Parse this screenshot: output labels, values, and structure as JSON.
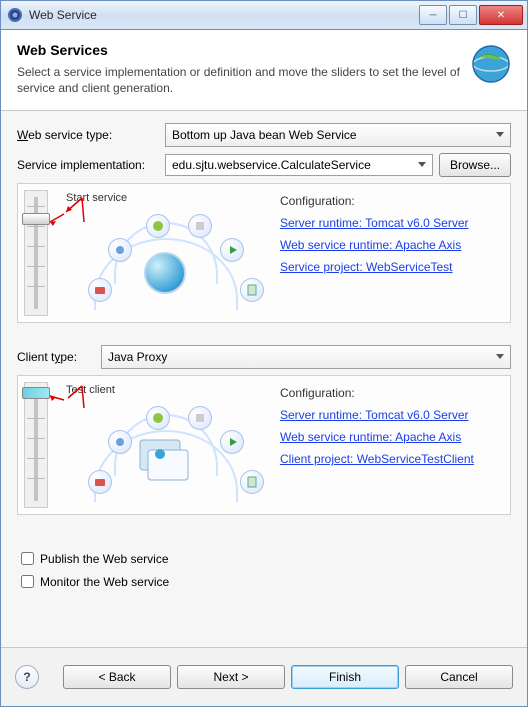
{
  "window": {
    "title": "Web Service"
  },
  "banner": {
    "title": "Web Services",
    "desc": "Select a service implementation or definition and move the sliders to set the level of service and client generation."
  },
  "ws_type": {
    "label_pre": "W",
    "label_rest": "eb service type:",
    "value": "Bottom up Java bean Web Service"
  },
  "impl": {
    "label": "Service implementation:",
    "value": "edu.sjtu.webservice.CalculateService",
    "browse_pre": "B",
    "browse_rest": "rowse..."
  },
  "server_section": {
    "annotation": "Start service",
    "conf_label": "Configuration:",
    "link1": "Server runtime: Tomcat v6.0 Server",
    "link2": "Web service runtime: Apache Axis",
    "link3": "Service project: WebServiceTest"
  },
  "client_type": {
    "label_pre": "Client t",
    "label_u": "y",
    "label_post": "pe:",
    "value": "Java Proxy"
  },
  "client_section": {
    "annotation": "Test client",
    "conf_label": "Configuration:",
    "link1": "Server runtime: Tomcat v6.0 Server",
    "link2": "Web service runtime: Apache Axis",
    "link3": "Client project: WebServiceTestClient"
  },
  "checks": {
    "publish_pre": "P",
    "publish_rest": "ublish the Web service",
    "monitor_pre": "M",
    "monitor_rest": "onitor the Web service"
  },
  "footer": {
    "back": "< Back",
    "next": "Next >",
    "finish": "Finish",
    "cancel": "Cancel"
  }
}
